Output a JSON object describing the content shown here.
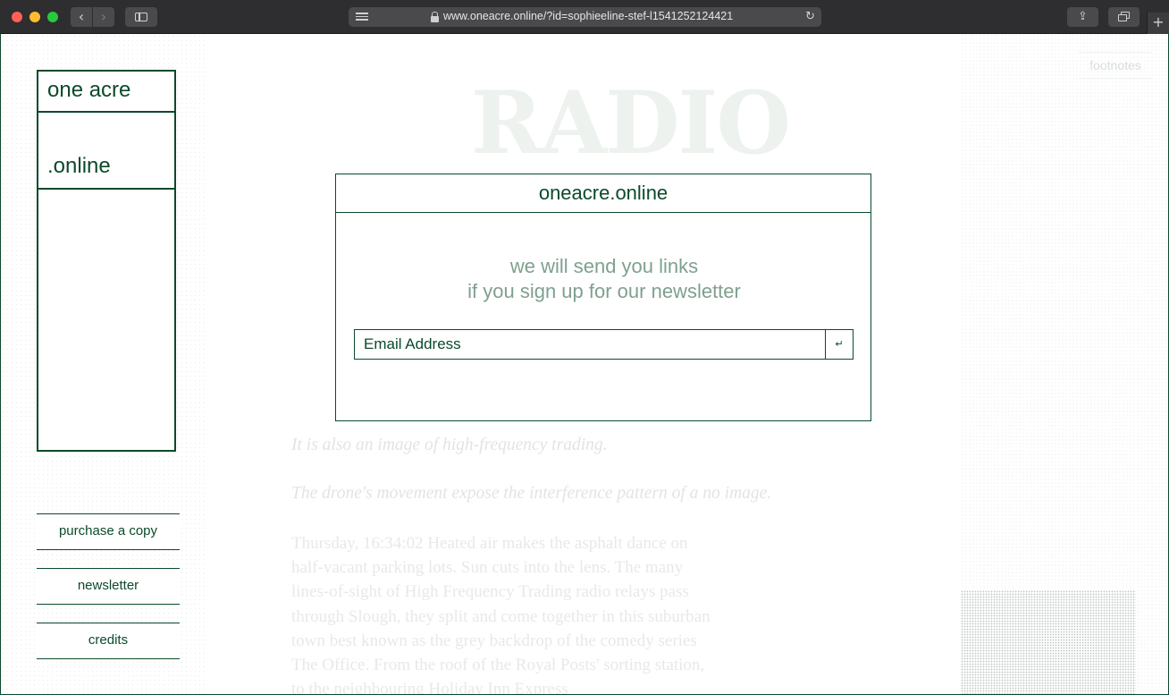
{
  "browser": {
    "url": "www.oneacre.online/?id=sophieeline-stef-l1541252124421",
    "back_glyph": "‹",
    "forward_glyph": "›",
    "reload_glyph": "↻",
    "share_glyph": "⇪",
    "newtab_glyph": "+"
  },
  "sidebar": {
    "logo_line1": "one acre",
    "logo_line2": ".online",
    "links": [
      {
        "label": "purchase a copy"
      },
      {
        "label": "newsletter"
      },
      {
        "label": "credits"
      }
    ]
  },
  "footnotes_label": "footnotes",
  "article": {
    "title": "RADIO",
    "italic_lines": [
      "It is also an image of high-frequency trading.",
      "The drone's movement expose the interference pattern of a no image."
    ],
    "paragraph": "Thursday, 16:34:02 Heated air makes the asphalt dance on half-vacant parking lots. Sun cuts into the lens. The many lines-of-sight of High Frequency Trading radio relays pass through Slough, they split and come together in this suburban town best known as the grey backdrop of the comedy series The Office. From the roof of the Royal Posts' sorting station, to the neighbouring Holiday Inn Express"
  },
  "modal": {
    "title": "oneacre.online",
    "message_line1": "we will send you links",
    "message_line2": "if you sign up for our newsletter",
    "email_placeholder": "Email Address",
    "submit_glyph": "↵"
  },
  "colors": {
    "brand_green": "#0b4a2b",
    "message_green": "#7fa08f"
  }
}
